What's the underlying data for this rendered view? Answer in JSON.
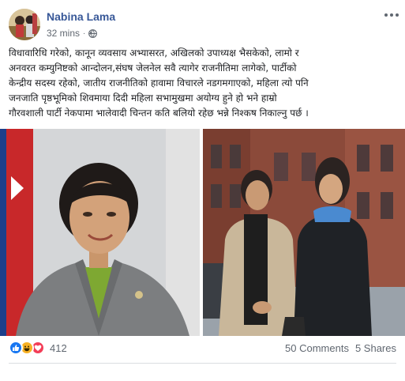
{
  "post": {
    "author": "Nabina Lama",
    "time": "32 mins",
    "separator": "·",
    "privacy_icon": "globe-icon",
    "more_icon": "more-options-icon",
    "text_lines": [
      "विधावारिधि गरेको, कानून व्यवसाय अभ्यासरत, अखिलको उपाध्यक्ष भैसकेको, लामो र",
      "अनवरत कम्युनिष्टको आन्दोलन,संघष जेलनेल सवै त्यागेर राजनीतिमा लागेको, पार्टीको",
      "केन्द्रीय सदस्य रहेको, जातीय राजनीतिको हावामा विचारले नडगमगाएको, महिला त्यो पनि",
      "जनजाति पृष्ठभूमिको शिवमाया दिदी महिला सभामुखमा अयोग्य हुने हो भने हाम्रो",
      "गौरवशाली पार्टी नेकपामा भालेवादी चिन्तन कति बलियो रहेछ भन्ने निश्कष निकाल्नु पर्छ ।"
    ]
  },
  "photos": [
    {
      "name": "portrait-photo",
      "description_icon": "photo-icon"
    },
    {
      "name": "street-photo",
      "description_icon": "photo-icon"
    }
  ],
  "footer": {
    "reactions": [
      "like-icon",
      "haha-icon",
      "love-icon"
    ],
    "reaction_count": "412",
    "comments": "50 Comments",
    "shares": "5 Shares"
  },
  "colors": {
    "author": "#385898",
    "meta": "#606770",
    "like": "#1877f2",
    "haha": "#f7b125",
    "love": "#f33e58"
  }
}
